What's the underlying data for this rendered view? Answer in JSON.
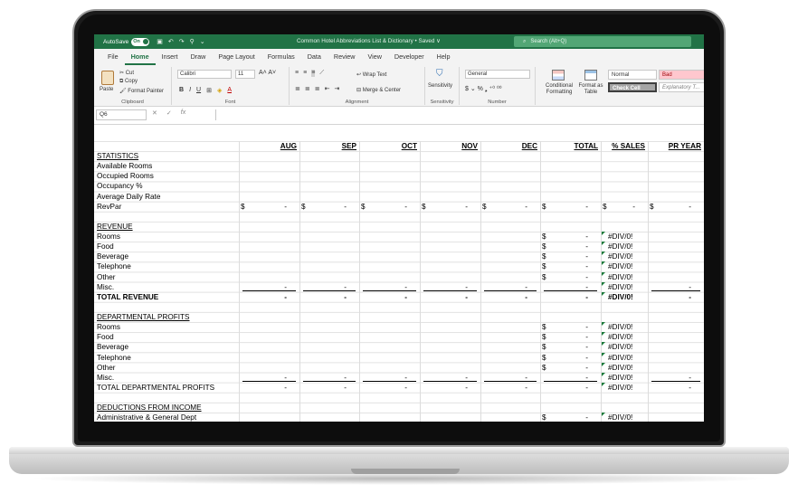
{
  "excel": {
    "autosave_label": "AutoSave",
    "autosave_state": "On",
    "doc_title": "Common Hotel Abbreviations List & Dictionary • Saved ∨",
    "search_placeholder": "Search (Alt+Q)",
    "menu": [
      "File",
      "Home",
      "Insert",
      "Draw",
      "Page Layout",
      "Formulas",
      "Data",
      "Review",
      "View",
      "Developer",
      "Help"
    ],
    "ribbon": {
      "paste": "Paste",
      "cut": "Cut",
      "copy": "Copy",
      "format_painter": "Format Painter",
      "clipboard": "Clipboard",
      "font_name": "Calibri",
      "font_size": "11",
      "font": "Font",
      "wrap_text": "Wrap Text",
      "merge_center": "Merge & Center",
      "alignment": "Alignment",
      "sensitivity": "Sensitivity",
      "number_format": "General",
      "number": "Number",
      "conditional_formatting": "Conditional Formatting",
      "format_as_table": "Format as Table",
      "style_normal": "Normal",
      "style_bad": "Bad",
      "style_check_cell": "Check Cell",
      "style_explanatory": "Explanatory T..."
    },
    "name_box": "Q6",
    "colors": {
      "excel_green": "#217346",
      "bad_fill": "#ffc7ce",
      "bad_text": "#9c0006",
      "check_fill": "#a5a5a5"
    }
  },
  "sheet": {
    "headers": [
      "AUG",
      "SEP",
      "OCT",
      "NOV",
      "DEC",
      "TOTAL",
      "% SALES",
      "PR YEAR"
    ],
    "sections": {
      "statistics": "STATISTICS",
      "stats_rows": [
        "Available Rooms",
        "Occupied Rooms",
        "Occupancy %",
        "Average Daily Rate",
        "RevPar"
      ],
      "revenue": "REVENUE",
      "revenue_rows": [
        "Rooms",
        "Food",
        "Beverage",
        "Telephone",
        "Other",
        "Misc."
      ],
      "total_revenue": "TOTAL REVENUE",
      "dept_profits": "DEPARTMENTAL PROFITS",
      "dept_rows": [
        "Rooms",
        "Food",
        "Beverage",
        "Telephone",
        "Other",
        "Misc."
      ],
      "total_dept": "TOTAL DEPARTMENTAL PROFITS",
      "deductions": "DEDUCTIONS FROM INCOME",
      "deduction_rows": [
        "Administrative & General Dept"
      ]
    },
    "dollar": "$",
    "dash": "-",
    "div0": "#DIV/0!"
  }
}
